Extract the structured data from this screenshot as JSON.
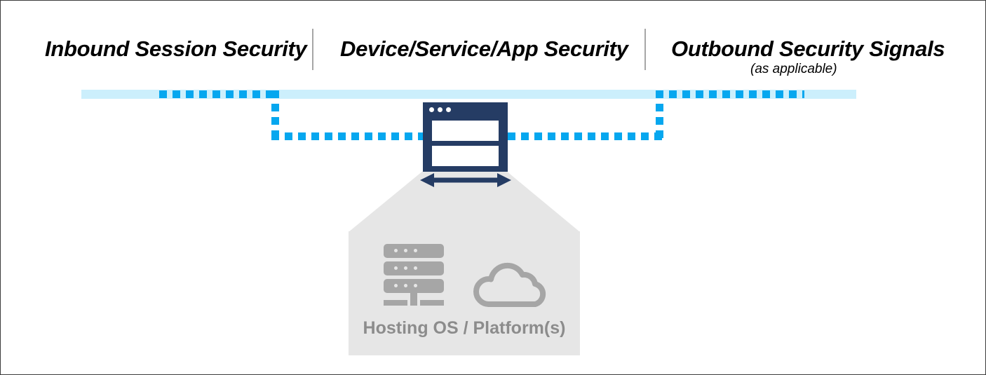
{
  "diagram": {
    "headers": [
      {
        "id": "inbound",
        "label": "Inbound Session Security"
      },
      {
        "id": "device",
        "label": "Device/Service/App Security"
      },
      {
        "id": "outbound",
        "label": "Outbound Security Signals",
        "sublabel": "(as applicable)"
      }
    ],
    "center_node": {
      "icon": "browser-window-icon",
      "dots": 3,
      "panes": 2
    },
    "platform": {
      "label": "Hosting OS / Platform(s)",
      "icons": [
        {
          "name": "server-stack-icon",
          "bars": 3,
          "dots_per_bar": 3
        },
        {
          "name": "cloud-icon"
        }
      ]
    },
    "connector": {
      "name": "bidirectional-arrow",
      "direction": "both"
    },
    "flow_line": {
      "name": "security-signal-path",
      "style": "dashed",
      "segments": [
        "top-left-horizontal",
        "left-vertical-down",
        "mid-left-horizontal",
        "mid-right-horizontal",
        "right-vertical-up",
        "top-right-horizontal"
      ]
    },
    "colors": {
      "band": "#cceffc",
      "dash": "#06a7ef",
      "navy": "#253c64",
      "platform_bg": "#e6e6e6",
      "platform_icon": "#a6a6a6",
      "platform_text": "#8c8c8c",
      "divider": "#a6a6a6",
      "border": "#3c3c3c"
    }
  }
}
